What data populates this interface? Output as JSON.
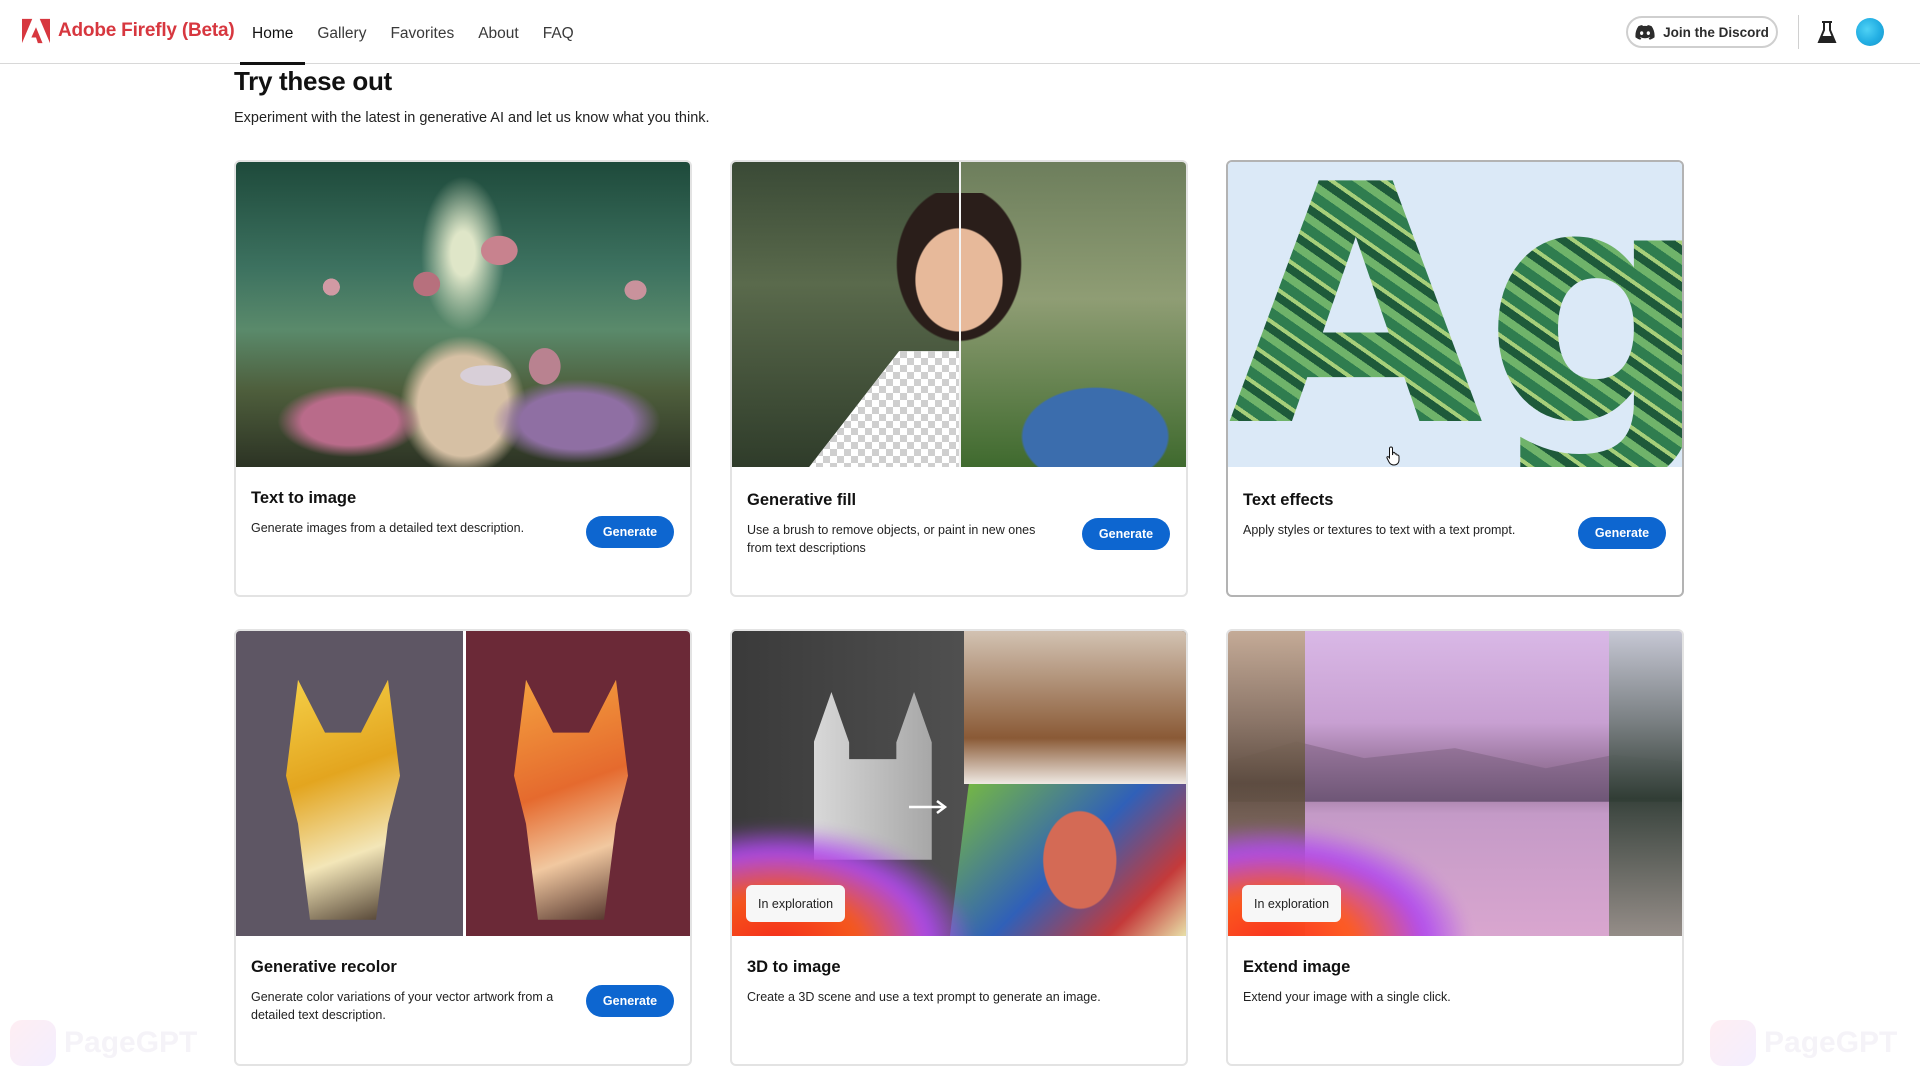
{
  "header": {
    "brand": "Adobe Firefly (Beta)",
    "brand_color": "#d7373f",
    "nav": [
      {
        "label": "Home",
        "active": true
      },
      {
        "label": "Gallery",
        "active": false
      },
      {
        "label": "Favorites",
        "active": false
      },
      {
        "label": "About",
        "active": false
      },
      {
        "label": "FAQ",
        "active": false
      }
    ],
    "discord_button": "Join the Discord",
    "icons": {
      "discord": "discord-icon",
      "labs": "flask-icon",
      "avatar": "user-avatar"
    }
  },
  "intro": {
    "title": "Try these out",
    "subtitle": "Experiment with the latest in generative AI and let us know what you think."
  },
  "accent_color": "#0d66d0",
  "cards": [
    {
      "title": "Text to image",
      "description": "Generate images from a detailed text description.",
      "button": "Generate",
      "badge": null
    },
    {
      "title": "Generative fill",
      "description": "Use a brush to remove objects, or paint in new ones from text descriptions",
      "button": "Generate",
      "badge": null
    },
    {
      "title": "Text effects",
      "description": "Apply styles or textures to text with a text prompt.",
      "button": "Generate",
      "badge": null,
      "preview_letters": "Ag"
    },
    {
      "title": "Generative recolor",
      "description": "Generate color variations of your vector artwork from a detailed text description.",
      "button": "Generate",
      "badge": null
    },
    {
      "title": "3D to image",
      "description": "Create a 3D scene and use a text prompt to generate an image.",
      "button": null,
      "badge": "In exploration"
    },
    {
      "title": "Extend image",
      "description": "Extend your image with a single click.",
      "button": null,
      "badge": "In exploration"
    }
  ],
  "watermark": "PageGPT"
}
